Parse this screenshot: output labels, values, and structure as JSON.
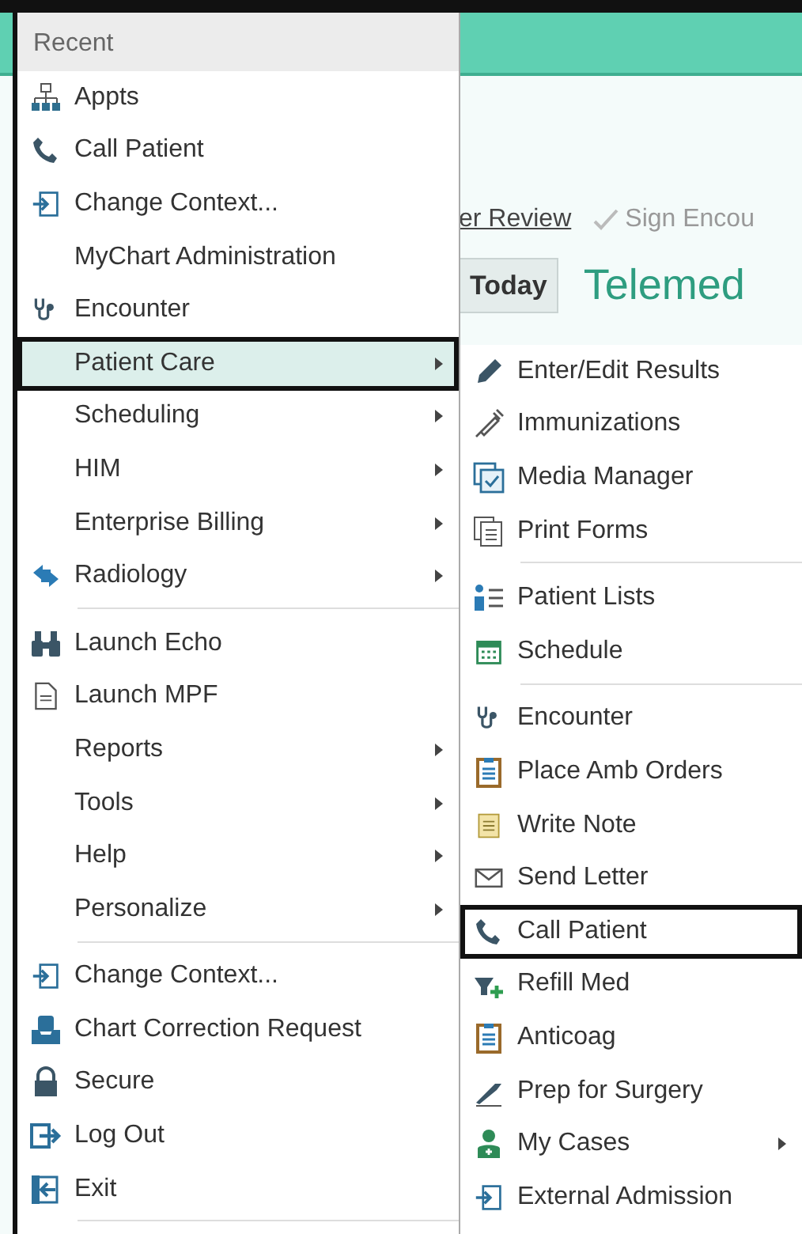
{
  "background": {
    "review_link": "er Review",
    "sign_button": "Sign Encou",
    "today_button": "Today",
    "heading": "Telemed"
  },
  "menu": {
    "header": "Recent",
    "items": [
      {
        "kind": "item",
        "label": "Appts",
        "selected": false,
        "submenu": false,
        "outlined": false
      },
      {
        "kind": "item",
        "label": "Call Patient",
        "selected": false,
        "submenu": false,
        "outlined": false
      },
      {
        "kind": "item",
        "label": "Change Context...",
        "selected": false,
        "submenu": false,
        "outlined": false
      },
      {
        "kind": "item",
        "label": "MyChart Administration",
        "selected": false,
        "submenu": false,
        "outlined": false
      },
      {
        "kind": "item",
        "label": "Encounter",
        "selected": false,
        "submenu": false,
        "outlined": false
      },
      {
        "kind": "item",
        "label": "Patient Care",
        "selected": true,
        "submenu": true,
        "outlined": true
      },
      {
        "kind": "item",
        "label": "Scheduling",
        "selected": false,
        "submenu": true,
        "outlined": false
      },
      {
        "kind": "item",
        "label": "HIM",
        "selected": false,
        "submenu": true,
        "outlined": false
      },
      {
        "kind": "item",
        "label": "Enterprise Billing",
        "selected": false,
        "submenu": true,
        "outlined": false
      },
      {
        "kind": "item",
        "label": "Radiology",
        "selected": false,
        "submenu": true,
        "outlined": false
      },
      {
        "kind": "separator"
      },
      {
        "kind": "item",
        "label": "Launch Echo",
        "selected": false,
        "submenu": false,
        "outlined": false
      },
      {
        "kind": "item",
        "label": "Launch MPF",
        "selected": false,
        "submenu": false,
        "outlined": false
      },
      {
        "kind": "item",
        "label": "Reports",
        "selected": false,
        "submenu": true,
        "outlined": false
      },
      {
        "kind": "item",
        "label": "Tools",
        "selected": false,
        "submenu": true,
        "outlined": false
      },
      {
        "kind": "item",
        "label": "Help",
        "selected": false,
        "submenu": true,
        "outlined": false
      },
      {
        "kind": "item",
        "label": "Personalize",
        "selected": false,
        "submenu": true,
        "outlined": false
      },
      {
        "kind": "separator"
      },
      {
        "kind": "item",
        "label": "Change Context...",
        "selected": false,
        "submenu": false,
        "outlined": false
      },
      {
        "kind": "item",
        "label": "Chart Correction Request",
        "selected": false,
        "submenu": false,
        "outlined": false
      },
      {
        "kind": "item",
        "label": "Secure",
        "selected": false,
        "submenu": false,
        "outlined": false
      },
      {
        "kind": "item",
        "label": "Log Out",
        "selected": false,
        "submenu": false,
        "outlined": false
      },
      {
        "kind": "item",
        "label": "Exit",
        "selected": false,
        "submenu": false,
        "outlined": false
      },
      {
        "kind": "separator"
      }
    ]
  },
  "submenu": {
    "items": [
      {
        "kind": "item",
        "label": "Enter/Edit Results",
        "selected": false,
        "submenu": false,
        "outlined": false
      },
      {
        "kind": "item",
        "label": "Immunizations",
        "selected": false,
        "submenu": false,
        "outlined": false
      },
      {
        "kind": "item",
        "label": "Media Manager",
        "selected": false,
        "submenu": false,
        "outlined": false
      },
      {
        "kind": "item",
        "label": "Print Forms",
        "selected": false,
        "submenu": false,
        "outlined": false
      },
      {
        "kind": "separator"
      },
      {
        "kind": "item",
        "label": "Patient Lists",
        "selected": false,
        "submenu": false,
        "outlined": false
      },
      {
        "kind": "item",
        "label": "Schedule",
        "selected": false,
        "submenu": false,
        "outlined": false
      },
      {
        "kind": "separator"
      },
      {
        "kind": "item",
        "label": "Encounter",
        "selected": false,
        "submenu": false,
        "outlined": false
      },
      {
        "kind": "item",
        "label": "Place Amb Orders",
        "selected": false,
        "submenu": false,
        "outlined": false
      },
      {
        "kind": "item",
        "label": "Write Note",
        "selected": false,
        "submenu": false,
        "outlined": false
      },
      {
        "kind": "item",
        "label": "Send Letter",
        "selected": false,
        "submenu": false,
        "outlined": false
      },
      {
        "kind": "item",
        "label": "Call Patient",
        "selected": false,
        "submenu": false,
        "outlined": true
      },
      {
        "kind": "item",
        "label": "Refill Med",
        "selected": false,
        "submenu": false,
        "outlined": false
      },
      {
        "kind": "item",
        "label": "Anticoag",
        "selected": false,
        "submenu": false,
        "outlined": false
      },
      {
        "kind": "item",
        "label": "Prep for Surgery",
        "selected": false,
        "submenu": false,
        "outlined": false
      },
      {
        "kind": "item",
        "label": "My Cases",
        "selected": false,
        "submenu": true,
        "outlined": false
      },
      {
        "kind": "item",
        "label": "External Admission",
        "selected": false,
        "submenu": false,
        "outlined": false
      }
    ]
  }
}
